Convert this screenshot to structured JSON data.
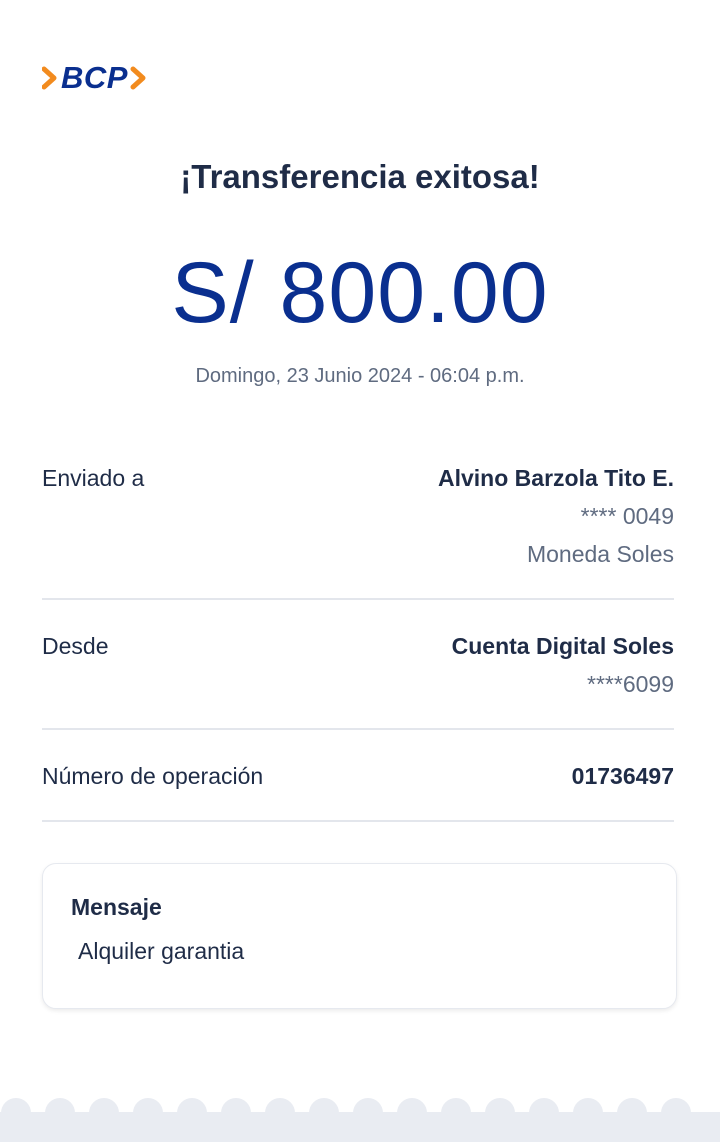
{
  "brand": {
    "logo_text": "BCP",
    "primary_color": "#0a2f8f",
    "accent_color": "#f28b1e"
  },
  "header": {
    "title": "¡Transferencia exitosa!"
  },
  "transfer": {
    "amount": "S/ 800.00",
    "datetime": "Domingo, 23 Junio 2024 - 06:04 p.m."
  },
  "details": {
    "sent_to": {
      "label": "Enviado a",
      "name": "Alvino Barzola Tito E.",
      "account": "**** 0049",
      "currency": "Moneda Soles"
    },
    "from": {
      "label": "Desde",
      "account_name": "Cuenta Digital Soles",
      "account_number": "****6099"
    },
    "operation": {
      "label": "Número de operación",
      "number": "01736497"
    }
  },
  "message": {
    "title": "Mensaje",
    "body": "Alquiler garantia"
  }
}
